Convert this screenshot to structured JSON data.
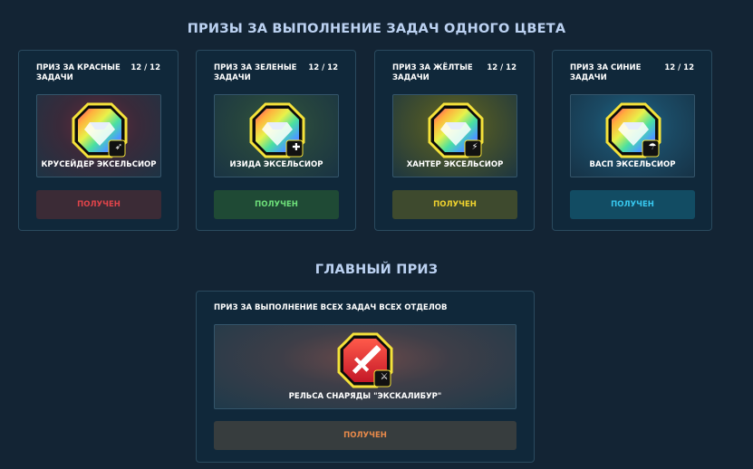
{
  "titles": {
    "colors": "ПРИЗЫ ЗА ВЫПОЛНЕНИЕ ЗАДАЧ ОДНОГО ЦВЕТА",
    "main": "ГЛАВНЫЙ ПРИЗ"
  },
  "cards": [
    {
      "heading": "ПРИЗ ЗА КРАСНЫЕ ЗАДАЧИ",
      "count": "12 / 12",
      "prize": "КРУСЕЙДЕР ЭКСЕЛЬСИОР",
      "status": "ПОЛУЧЕН",
      "color": "#e0444a",
      "icon": "wing-icon"
    },
    {
      "heading": "ПРИЗ ЗА ЗЕЛЕНЫЕ ЗАДАЧИ",
      "count": "12 / 12",
      "prize": "ИЗИДА ЭКСЕЛЬСИОР",
      "status": "ПОЛУЧЕН",
      "color": "#6ee07a",
      "icon": "plus-icon"
    },
    {
      "heading": "ПРИЗ ЗА ЖЁЛТЫЕ ЗАДАЧИ",
      "count": "12 / 12",
      "prize": "ХАНТЕР ЭКСЕЛЬСИОР",
      "status": "ПОЛУЧЕН",
      "color": "#f0d32e",
      "icon": "lightning-icon"
    },
    {
      "heading": "ПРИЗ ЗА СИНИЕ ЗАДАЧИ",
      "count": "12 / 12",
      "prize": "ВАСП ЭКСЕЛЬСИОР",
      "status": "ПОЛУЧЕН",
      "color": "#38c8ef",
      "icon": "umbrella-icon"
    }
  ],
  "main": {
    "heading": "ПРИЗ ЗА ВЫПОЛНЕНИЕ ВСЕХ ЗАДАЧ ВСЕХ ОТДЕЛОВ",
    "prize": "РЕЛЬСА СНАРЯДЫ \"ЭКСКАЛИБУР\"",
    "status": "ПОЛУЧЕН",
    "color": "#e98a4a",
    "icon": "sword-icon"
  }
}
